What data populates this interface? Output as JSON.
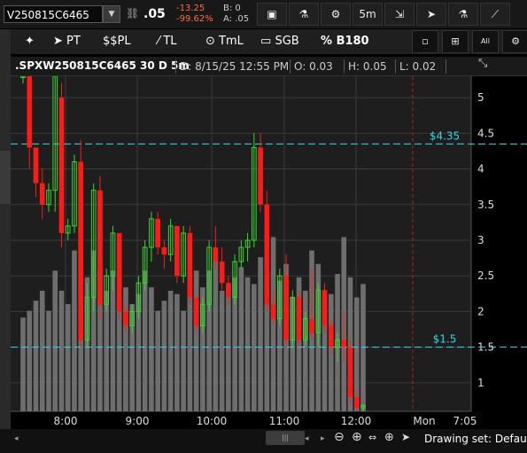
{
  "toolbar": {
    "symbol": "V250815C6465",
    "last": ".05",
    "net_change": "-13.25",
    "net_change_pct": "-99.62%",
    "bid": "B: 0",
    "ask": "A: .05",
    "timeframe": "5m",
    "icons": [
      "link-icon",
      "quote-icon",
      "flask-icon",
      "gear-icon",
      "timeframe-dropdown",
      "cursor-style-icon",
      "pointer-icon",
      "flask-icon-2",
      "chart-style-icon"
    ]
  },
  "drawing_toolbar": {
    "items": [
      {
        "icon": "pin-icon",
        "label": ""
      },
      {
        "icon": "pointer-icon",
        "label": "PT"
      },
      {
        "icon": "dollar-icon",
        "label": "$PL"
      },
      {
        "icon": "trendline-icon",
        "label": "TL"
      },
      {
        "icon": "timeline-icon",
        "label": "TmL"
      },
      {
        "icon": "rectangle-icon",
        "label": "SGB"
      },
      {
        "icon": "percent-icon",
        "label": "B180"
      }
    ],
    "right_buttons": [
      "square-icon",
      "grid-icon",
      "all-label",
      "gear-icon"
    ],
    "all_label": "All"
  },
  "info": {
    "symbol": ".SPXW250815C6465 30 D 5m",
    "date": "D: 8/15/25 12:55 PM",
    "open": "O: 0.03",
    "high": "H: 0.05",
    "low": "L: 0.02"
  },
  "chart_data": {
    "type": "candlestick",
    "x_ticks": [
      "8:00",
      "9:00",
      "10:00",
      "11:00",
      "12:00",
      "Mon",
      "7:05"
    ],
    "y_ticks": [
      "5",
      "4.5",
      "4",
      "3.5",
      "3",
      "2.5",
      "2",
      "1.5",
      "1"
    ],
    "ylim": [
      0.6,
      5.3
    ],
    "price_lines": [
      {
        "label": "$4.35",
        "value": 4.35
      },
      {
        "label": "$1.5",
        "value": 1.5
      }
    ],
    "colors": {
      "up": "#37d82e",
      "down": "#ff1a1a",
      "volume": "#6e6e6e",
      "price_line": "#2fd9e6",
      "grid": "#3a3a3a",
      "bg": "#1e1e1e"
    },
    "candles": [
      [
        5.3,
        5.5,
        5.2,
        5.3
      ],
      [
        5.3,
        5.5,
        4.0,
        4.3
      ],
      [
        4.3,
        4.3,
        3.6,
        3.8
      ],
      [
        3.8,
        4.0,
        3.3,
        3.5
      ],
      [
        3.5,
        3.8,
        3.4,
        3.7
      ],
      [
        3.7,
        5.5,
        3.4,
        5.3
      ],
      [
        5.0,
        5.2,
        2.9,
        3.1
      ],
      [
        3.1,
        3.3,
        3.0,
        3.2
      ],
      [
        3.2,
        4.2,
        3.1,
        4.1
      ],
      [
        4.1,
        4.4,
        1.5,
        1.6
      ],
      [
        1.6,
        2.4,
        1.5,
        2.2
      ],
      [
        2.2,
        3.8,
        2.0,
        3.7
      ],
      [
        3.7,
        3.9,
        1.9,
        2.1
      ],
      [
        2.1,
        2.6,
        2.0,
        2.5
      ],
      [
        2.5,
        3.2,
        2.3,
        3.1
      ],
      [
        3.1,
        3.1,
        1.9,
        2.0
      ],
      [
        2.0,
        2.1,
        1.7,
        1.8
      ],
      [
        1.8,
        2.1,
        1.7,
        2.0
      ],
      [
        2.0,
        2.5,
        1.9,
        2.4
      ],
      [
        2.4,
        3.0,
        2.3,
        2.9
      ],
      [
        2.9,
        3.4,
        2.7,
        3.3
      ],
      [
        3.3,
        3.4,
        2.8,
        2.9
      ],
      [
        2.9,
        3.0,
        2.6,
        2.8
      ],
      [
        2.8,
        3.3,
        2.7,
        3.2
      ],
      [
        3.2,
        3.2,
        2.4,
        2.5
      ],
      [
        2.5,
        3.2,
        2.4,
        3.1
      ],
      [
        3.1,
        3.2,
        2.1,
        2.2
      ],
      [
        2.2,
        2.2,
        1.7,
        1.8
      ],
      [
        1.8,
        2.2,
        1.7,
        2.1
      ],
      [
        2.1,
        3.0,
        2.0,
        2.9
      ],
      [
        2.9,
        3.2,
        2.6,
        2.7
      ],
      [
        2.7,
        2.9,
        2.3,
        2.4
      ],
      [
        2.4,
        2.5,
        2.1,
        2.2
      ],
      [
        2.2,
        2.8,
        2.1,
        2.7
      ],
      [
        2.7,
        3.0,
        2.6,
        2.9
      ],
      [
        2.9,
        3.1,
        2.7,
        3.0
      ],
      [
        3.0,
        4.5,
        2.9,
        4.3
      ],
      [
        4.3,
        4.5,
        3.4,
        3.5
      ],
      [
        3.5,
        3.7,
        2.0,
        2.1
      ],
      [
        2.1,
        2.3,
        1.8,
        1.9
      ],
      [
        1.9,
        2.6,
        1.8,
        2.5
      ],
      [
        2.5,
        2.8,
        1.5,
        1.6
      ],
      [
        1.6,
        2.3,
        1.5,
        2.2
      ],
      [
        2.2,
        2.3,
        1.5,
        1.6
      ],
      [
        1.6,
        2.0,
        1.5,
        1.9
      ],
      [
        1.9,
        2.6,
        1.6,
        1.7
      ],
      [
        1.7,
        2.4,
        1.5,
        2.3
      ],
      [
        2.3,
        2.4,
        1.7,
        1.8
      ],
      [
        1.8,
        1.9,
        1.4,
        1.5
      ],
      [
        1.5,
        1.7,
        1.3,
        1.6
      ],
      [
        1.6,
        2.0,
        1.3,
        1.5
      ],
      [
        1.5,
        1.6,
        0.7,
        0.8
      ],
      [
        0.8,
        0.9,
        0.6,
        0.65
      ],
      [
        0.65,
        0.7,
        0.6,
        0.68
      ]
    ],
    "volume": [
      0.28,
      0.3,
      0.33,
      0.36,
      0.3,
      0.42,
      0.36,
      0.32,
      0.48,
      0.55,
      0.4,
      0.48,
      0.42,
      0.36,
      0.42,
      0.33,
      0.37,
      0.32,
      0.35,
      0.42,
      0.37,
      0.3,
      0.33,
      0.36,
      0.35,
      0.3,
      0.39,
      0.42,
      0.37,
      0.42,
      0.46,
      0.36,
      0.38,
      0.4,
      0.43,
      0.4,
      0.38,
      0.46,
      0.42,
      0.52,
      0.39,
      0.44,
      0.34,
      0.4,
      0.36,
      0.48,
      0.44,
      0.34,
      0.35,
      0.41,
      0.52,
      0.4,
      0.34,
      0.38
    ],
    "volume_scale_max_frac": 0.5
  },
  "statusbar": {
    "drawing_set": "Drawing set: Default"
  }
}
